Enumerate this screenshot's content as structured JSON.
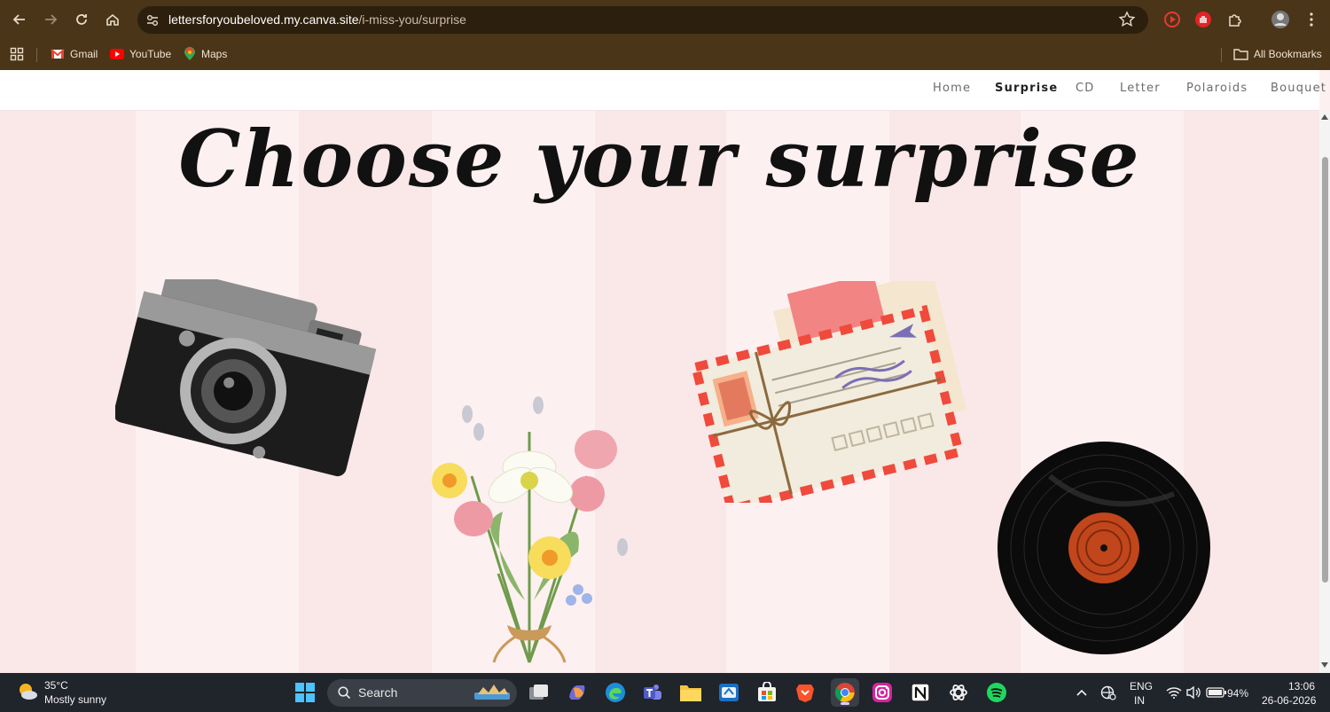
{
  "browser": {
    "url_host": "lettersforyoubeloved.my.canva.site",
    "url_path": "/i-miss-you/surprise",
    "bookmarks": [
      {
        "label": "Gmail",
        "icon": "gmail-icon"
      },
      {
        "label": "YouTube",
        "icon": "youtube-icon"
      },
      {
        "label": "Maps",
        "icon": "maps-icon"
      }
    ],
    "all_bookmarks": "All Bookmarks"
  },
  "site": {
    "nav": [
      {
        "label": "Home"
      },
      {
        "label": "Surprise"
      },
      {
        "label": "CD"
      },
      {
        "label": "Letter"
      },
      {
        "label": "Polaroids"
      },
      {
        "label": "Bouquet"
      }
    ],
    "active_nav": "Surprise",
    "headline": "Choose your surprise",
    "items": [
      {
        "icon": "camera-icon"
      },
      {
        "icon": "flower-bouquet-icon"
      },
      {
        "icon": "envelope-letter-icon"
      },
      {
        "icon": "vinyl-record-icon"
      }
    ]
  },
  "taskbar": {
    "weather_temp": "35°C",
    "weather_desc": "Mostly sunny",
    "search_label": "Search",
    "lang_top": "ENG",
    "lang_bottom": "IN",
    "battery": "94%",
    "time": "13:06",
    "date": "26-06-2026"
  },
  "colors": {
    "browser_frame": "#4a3519",
    "page_bg": "#fdf0f1",
    "stripe": "#fae7e8",
    "taskbar": "#20242b"
  }
}
